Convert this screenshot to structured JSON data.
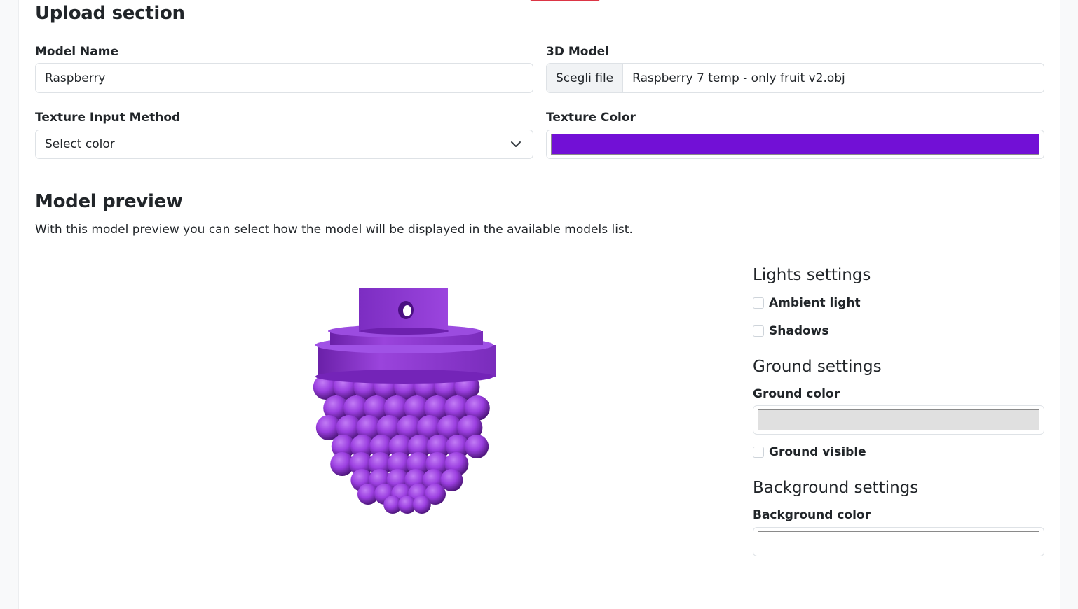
{
  "upload": {
    "title": "Upload section",
    "model_name_label": "Model Name",
    "model_name_value": "Raspberry",
    "model_file_label": "3D Model",
    "file_button_label": "Scegli file",
    "file_name": "Raspberry 7 temp - only fruit v2.obj",
    "texture_method_label": "Texture Input Method",
    "texture_method_value": "Select color",
    "texture_color_label": "Texture Color",
    "texture_color": "#7210d6"
  },
  "preview": {
    "title": "Model preview",
    "description": "With this model preview you can select how the model will be displayed in the available models list.",
    "model_color": "#9b3fe0"
  },
  "lights": {
    "title": "Lights settings",
    "ambient_label": "Ambient light",
    "ambient_checked": false,
    "shadows_label": "Shadows",
    "shadows_checked": false
  },
  "ground": {
    "title": "Ground settings",
    "color_label": "Ground color",
    "color": "#e0e0e0",
    "visible_label": "Ground visible",
    "visible_checked": false
  },
  "background": {
    "title": "Background settings",
    "color_label": "Background color",
    "color": "#ffffff"
  },
  "icons": {
    "select_arrow": "chevron-down-icon"
  }
}
